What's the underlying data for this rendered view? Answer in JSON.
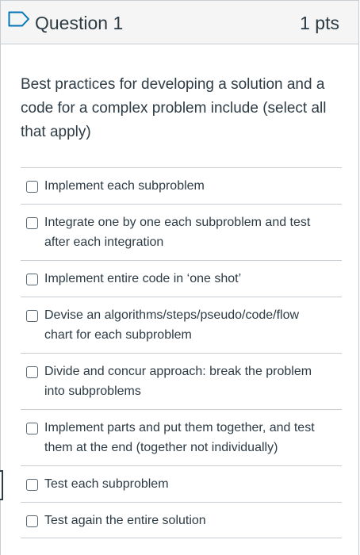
{
  "question": {
    "title": "Question 1",
    "points": "1 pts",
    "text": "Best practices for developing a solution and a code for a complex problem include (select all that apply)"
  },
  "answers": [
    {
      "label": "Implement each subproblem",
      "checked": false
    },
    {
      "label": "Integrate one by one each subproblem and test after each integration",
      "checked": false
    },
    {
      "label": "Implement entire code in ‘one shot’",
      "checked": false
    },
    {
      "label": "Devise an algorithms/steps/pseudo/code/flow chart for each subproblem",
      "checked": false
    },
    {
      "label": "Divide and concur approach: break the problem into subproblems",
      "checked": false
    },
    {
      "label": "Implement parts and put them together, and test them at the end (together not individually)",
      "checked": false
    },
    {
      "label": "Test each subproblem",
      "checked": false
    },
    {
      "label": "Test again the entire solution",
      "checked": false
    }
  ],
  "colors": {
    "text": "#2d3b45",
    "border": "#c7cdd1",
    "header_bg": "#f5f5f5",
    "flag_outline": "#0374b5"
  },
  "icons": {
    "flag": "flag-icon",
    "checkbox": "checkbox-icon"
  }
}
